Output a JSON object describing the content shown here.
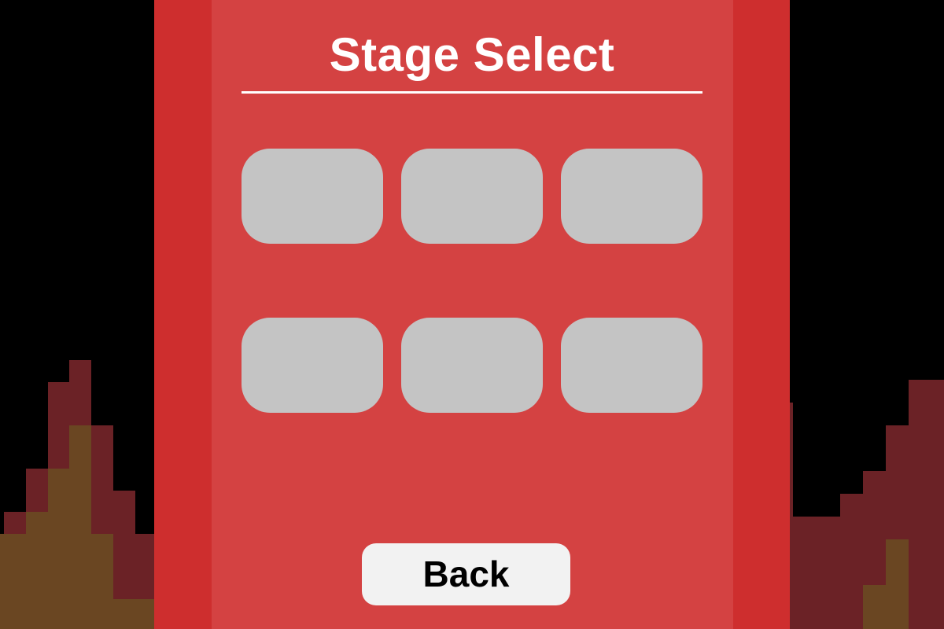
{
  "screen": {
    "title": "Stage Select"
  },
  "stages": [
    {
      "label": ""
    },
    {
      "label": ""
    },
    {
      "label": ""
    },
    {
      "label": ""
    },
    {
      "label": ""
    },
    {
      "label": ""
    }
  ],
  "back_button": {
    "label": "Back"
  },
  "colors": {
    "background": "#000000",
    "panel_outer": "#ce2e2e",
    "panel_inner": "#d44242",
    "stage_button": "#c4c4c4",
    "back_button": "#f2f2f2",
    "flame_outer": "#6b2226",
    "flame_inner": "#6a4622",
    "title_text": "#ffffff"
  }
}
